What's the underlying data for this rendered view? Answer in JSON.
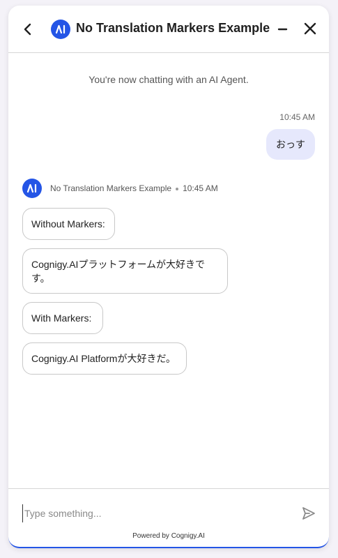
{
  "header": {
    "title": "No Translation Markers Example",
    "back_icon": "chevron-left-icon",
    "minimize_icon": "minimize-icon",
    "close_icon": "close-icon",
    "logo_icon": "ai-logo-icon"
  },
  "chat": {
    "system_message": "You're now chatting with an AI Agent.",
    "user_message": {
      "time": "10:45 AM",
      "text": "おっす"
    },
    "bot": {
      "name": "No Translation Markers Example",
      "time": "10:45 AM",
      "messages": [
        "Without Markers:",
        "Cognigy.AIプラットフォームが大好きです。",
        "With Markers:",
        "Cognigy.AI Platformが大好きだ。"
      ]
    }
  },
  "composer": {
    "placeholder": "Type something...",
    "value": "",
    "send_icon": "send-icon"
  },
  "footer": {
    "powered_by": "Powered by Cognigy.AI"
  },
  "colors": {
    "accent": "#2455e6",
    "user_bubble": "#e6e8fc"
  }
}
